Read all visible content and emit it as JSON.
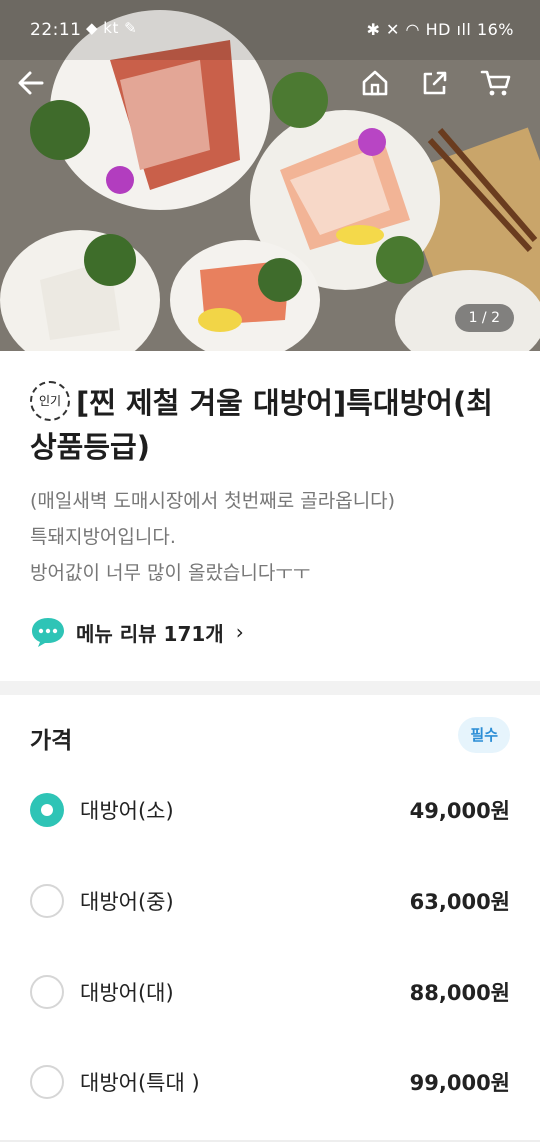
{
  "status_bar": {
    "time": "22:11",
    "left_icons": "◆ kt ✎",
    "right": "✱ ✕ ◠ HD ıll 16%"
  },
  "hero": {
    "counter": "1 / 2"
  },
  "product": {
    "badge": "인기",
    "title": "[찐 제철 겨울 대방어]특대방어(최상품등급)",
    "description": "(매일새벽 도매시장에서 첫번째로 골라옵니다)\n특돼지방어입니다.\n방어값이  너무  많이 올랐습니다ㅜㅜ",
    "review_label": "메뉴 리뷰 171개",
    "review_chevron": "›"
  },
  "price": {
    "title": "가격",
    "required": "필수",
    "options": [
      {
        "label": "대방어(소)",
        "price": "49,000원",
        "selected": true
      },
      {
        "label": "대방어(중)",
        "price": "63,000원",
        "selected": false
      },
      {
        "label": "대방어(대)",
        "price": "88,000원",
        "selected": false
      },
      {
        "label": "대방어(특대 )",
        "price": "99,000원",
        "selected": false
      }
    ]
  },
  "colors": {
    "accent": "#2ec4b6",
    "required_bg": "#e6f4fc",
    "required_text": "#2c8ed6"
  },
  "icons": {
    "back": "back-arrow-icon",
    "home": "home-icon",
    "share": "share-icon",
    "cart": "cart-icon",
    "review": "chat-bubble-icon"
  }
}
